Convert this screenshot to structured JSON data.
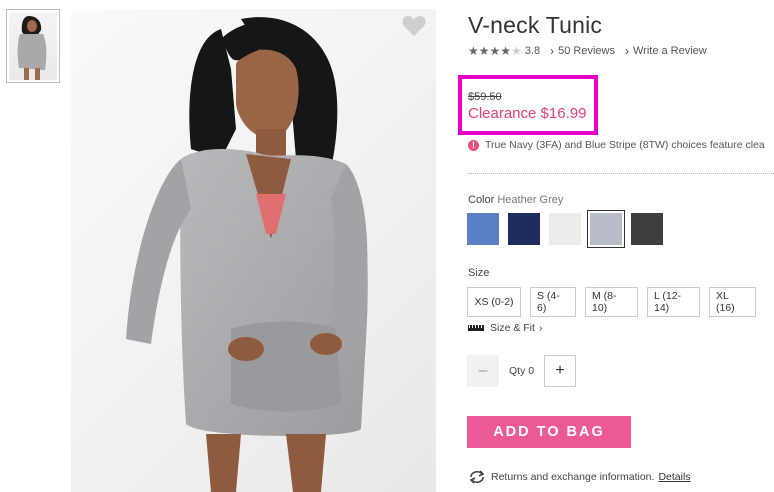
{
  "gallery": {
    "thumbnail_alt": "V-neck Tunic thumbnail",
    "main_image_alt": "Model wearing grey V-neck Tunic"
  },
  "product": {
    "title": "V-neck Tunic",
    "rating_value": "3.8",
    "rating_stars": 3.8,
    "reviews_link": "50 Reviews",
    "write_review_link": "Write a Review"
  },
  "price": {
    "original": "$59.50",
    "clearance": "Clearance $16.99",
    "highlight_color": "#e600c8",
    "clearance_color": "#e83e7b"
  },
  "notice": {
    "text": "True Navy (3FA) and Blue Stripe (8TW) choices feature clea"
  },
  "color": {
    "label": "Color",
    "selected": "Heather Grey",
    "swatches": [
      {
        "name": "Blue",
        "hex": "#5b7fc4"
      },
      {
        "name": "Navy",
        "hex": "#1e2d5e"
      },
      {
        "name": "White",
        "hex": "#ececec"
      },
      {
        "name": "Heather Grey",
        "hex": "#b8bcc8"
      },
      {
        "name": "Charcoal",
        "hex": "#3e3e3e"
      }
    ]
  },
  "size": {
    "label": "Size",
    "options": [
      "XS (0-2)",
      "S (4-6)",
      "M (8-10)",
      "L (12-14)",
      "XL (16)"
    ],
    "size_fit_link": "Size & Fit"
  },
  "quantity": {
    "minus": "–",
    "label": "Qty 0",
    "plus": "+"
  },
  "actions": {
    "add_to_bag": "ADD TO BAG",
    "add_color": "#ec5a96"
  },
  "returns": {
    "text": "Returns and exchange information.",
    "link": "Details"
  }
}
